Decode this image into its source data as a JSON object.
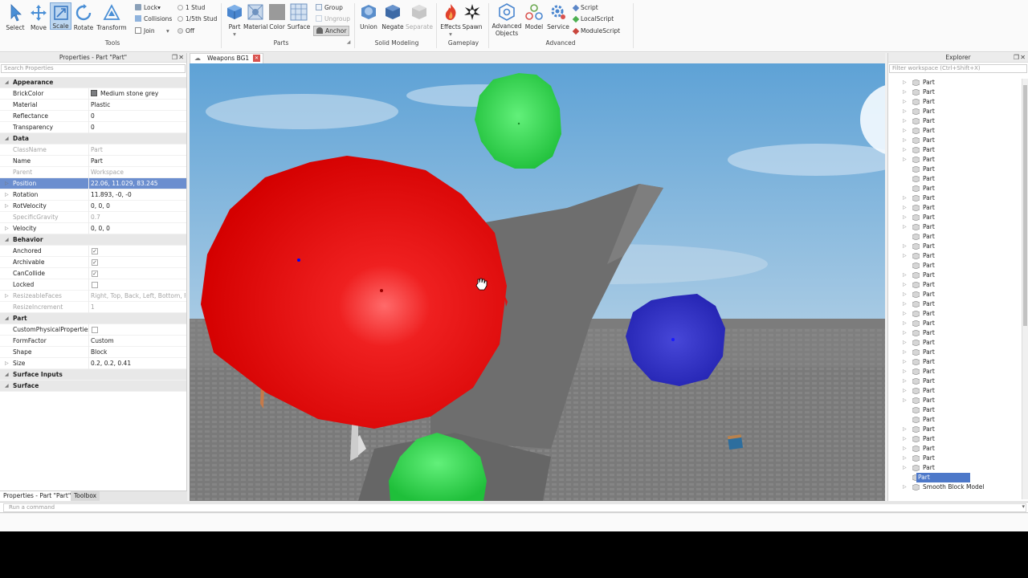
{
  "ribbon": {
    "tools": [
      "Select",
      "Move",
      "Scale",
      "Rotate",
      "Transform"
    ],
    "lock_group": [
      "Lock",
      "Collisions",
      "Join"
    ],
    "lock_suffix": "▾",
    "snap_group": [
      "1 Stud",
      "1/5th Stud",
      "Off"
    ],
    "tools_label": "Tools",
    "parts_buttons": [
      "Part",
      "Material",
      "Color",
      "Surface"
    ],
    "part_dropdown": "▾",
    "group_buttons": [
      "Group",
      "Ungroup",
      "Anchor"
    ],
    "parts_label": "Parts",
    "solid_buttons": [
      "Union",
      "Negate",
      "Separate"
    ],
    "solid_label": "Solid Modeling",
    "gameplay_buttons": [
      "Effects",
      "Spawn"
    ],
    "effects_dropdown": "▾",
    "gameplay_label": "Gameplay",
    "advanced_buttons": [
      "Advanced Objects",
      "Model",
      "Service"
    ],
    "script_buttons": [
      "Script",
      "LocalScript",
      "ModuleScript"
    ],
    "advanced_label": "Advanced"
  },
  "properties": {
    "title": "Properties - Part \"Part\"",
    "search_placeholder": "Search Properties",
    "rows": [
      {
        "kind": "cat",
        "name": "Appearance"
      },
      {
        "kind": "prop",
        "name": "BrickColor",
        "value": "Medium stone grey",
        "swatch": true
      },
      {
        "kind": "prop",
        "name": "Material",
        "value": "Plastic"
      },
      {
        "kind": "prop",
        "name": "Reflectance",
        "value": "0"
      },
      {
        "kind": "prop",
        "name": "Transparency",
        "value": "0"
      },
      {
        "kind": "cat",
        "name": "Data"
      },
      {
        "kind": "prop",
        "name": "ClassName",
        "value": "Part",
        "dim": true
      },
      {
        "kind": "prop",
        "name": "Name",
        "value": "Part"
      },
      {
        "kind": "prop",
        "name": "Parent",
        "value": "Workspace",
        "dim": true
      },
      {
        "kind": "prop",
        "name": "Position",
        "value": "22.06, 11.029, 83.245",
        "expand": true,
        "highlight": true
      },
      {
        "kind": "prop",
        "name": "Rotation",
        "value": "11.893, -0, -0",
        "expand": true
      },
      {
        "kind": "prop",
        "name": "RotVelocity",
        "value": "0, 0, 0",
        "expand": true
      },
      {
        "kind": "prop",
        "name": "SpecificGravity",
        "value": "0.7",
        "dim": true
      },
      {
        "kind": "prop",
        "name": "Velocity",
        "value": "0, 0, 0",
        "expand": true
      },
      {
        "kind": "cat",
        "name": "Behavior"
      },
      {
        "kind": "check",
        "name": "Anchored",
        "checked": true
      },
      {
        "kind": "check",
        "name": "Archivable",
        "checked": true
      },
      {
        "kind": "check",
        "name": "CanCollide",
        "checked": true
      },
      {
        "kind": "check",
        "name": "Locked",
        "checked": false
      },
      {
        "kind": "prop",
        "name": "ResizeableFaces",
        "value": "Right, Top, Back, Left, Bottom, F...",
        "dim": true,
        "expand": true
      },
      {
        "kind": "prop",
        "name": "ResizeIncrement",
        "value": "1",
        "dim": true
      },
      {
        "kind": "cat",
        "name": "Part"
      },
      {
        "kind": "check",
        "name": "CustomPhysicalProperties",
        "checked": false
      },
      {
        "kind": "prop",
        "name": "FormFactor",
        "value": "Custom"
      },
      {
        "kind": "prop",
        "name": "Shape",
        "value": "Block"
      },
      {
        "kind": "prop",
        "name": "Size",
        "value": "0.2, 0.2, 0.41",
        "expand": true
      },
      {
        "kind": "cat",
        "name": "Surface Inputs"
      },
      {
        "kind": "cat",
        "name": "Surface"
      }
    ],
    "bottom_tabs": [
      "Properties - Part \"Part\"",
      "Toolbox"
    ]
  },
  "viewport": {
    "tab_label": "Weapons BG1",
    "close": "✕"
  },
  "explorer": {
    "title": "Explorer",
    "filter_placeholder": "Filter workspace (Ctrl+Shift+X)",
    "items": [
      {
        "label": "Part",
        "expand": true
      },
      {
        "label": "Part",
        "expand": true
      },
      {
        "label": "Part",
        "expand": true
      },
      {
        "label": "Part",
        "expand": true
      },
      {
        "label": "Part",
        "expand": true
      },
      {
        "label": "Part",
        "expand": true
      },
      {
        "label": "Part",
        "expand": true
      },
      {
        "label": "Part",
        "expand": true
      },
      {
        "label": "Part",
        "expand": true
      },
      {
        "label": "Part",
        "expand": false
      },
      {
        "label": "Part",
        "expand": false
      },
      {
        "label": "Part",
        "expand": false
      },
      {
        "label": "Part",
        "expand": true
      },
      {
        "label": "Part",
        "expand": true
      },
      {
        "label": "Part",
        "expand": true
      },
      {
        "label": "Part",
        "expand": true
      },
      {
        "label": "Part",
        "expand": false
      },
      {
        "label": "Part",
        "expand": true
      },
      {
        "label": "Part",
        "expand": true
      },
      {
        "label": "Part",
        "expand": false
      },
      {
        "label": "Part",
        "expand": true
      },
      {
        "label": "Part",
        "expand": true
      },
      {
        "label": "Part",
        "expand": true
      },
      {
        "label": "Part",
        "expand": true
      },
      {
        "label": "Part",
        "expand": true
      },
      {
        "label": "Part",
        "expand": true
      },
      {
        "label": "Part",
        "expand": true
      },
      {
        "label": "Part",
        "expand": true
      },
      {
        "label": "Part",
        "expand": true
      },
      {
        "label": "Part",
        "expand": true
      },
      {
        "label": "Part",
        "expand": true
      },
      {
        "label": "Part",
        "expand": true
      },
      {
        "label": "Part",
        "expand": true
      },
      {
        "label": "Part",
        "expand": true
      },
      {
        "label": "Part",
        "expand": false
      },
      {
        "label": "Part",
        "expand": false
      },
      {
        "label": "Part",
        "expand": true
      },
      {
        "label": "Part",
        "expand": true
      },
      {
        "label": "Part",
        "expand": true
      },
      {
        "label": "Part",
        "expand": true
      },
      {
        "label": "Part",
        "expand": true
      },
      {
        "label": "Part",
        "expand": false,
        "selected": true
      },
      {
        "label": "Smooth Block Model",
        "expand": true
      }
    ]
  },
  "command_bar": {
    "placeholder": "Run a command",
    "dropdown": "▾"
  }
}
